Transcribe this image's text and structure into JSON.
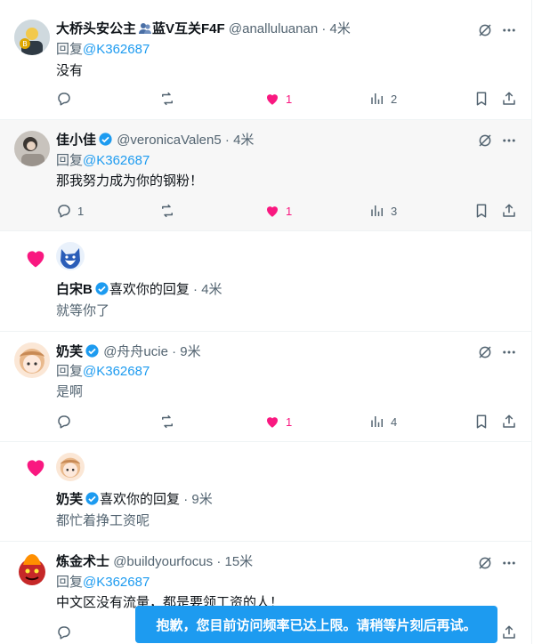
{
  "replies": [
    {
      "name": "大桥头安公主",
      "badge_text": "蓝V互关F4F",
      "handle": "@analluluanan",
      "time": "4米",
      "reply_prefix": "回复",
      "reply_to": "@K362687",
      "text": "没有",
      "counts": {
        "reply": "",
        "retweet": "",
        "like": "1",
        "views": "2"
      }
    },
    {
      "name": "佳小佳",
      "handle": "@veronicaValen5",
      "time": "4米",
      "reply_prefix": "回复",
      "reply_to": "@K362687",
      "text": "那我努力成为你的钢粉！",
      "counts": {
        "reply": "1",
        "retweet": "",
        "like": "1",
        "views": "3"
      }
    },
    {
      "name": "奶芙",
      "handle": "@舟舟ucie",
      "time": "9米",
      "reply_prefix": "回复",
      "reply_to": "@K362687",
      "text": "是啊",
      "counts": {
        "reply": "",
        "retweet": "",
        "like": "1",
        "views": "4"
      }
    },
    {
      "name": "炼金术士",
      "handle": "@buildyourfocus",
      "time": "15米",
      "reply_prefix": "回复",
      "reply_to": "@K362687",
      "text": "中文区没有流量，都是要领工资的人！",
      "counts": {
        "reply": "",
        "retweet": "",
        "like": "",
        "views": ""
      }
    }
  ],
  "likes": [
    {
      "name": "白宋B",
      "action": "喜欢你的回复",
      "time": "4米",
      "text": "就等你了"
    },
    {
      "name": "奶芙",
      "action": "喜欢你的回复",
      "time": "9米",
      "text": "都忙着挣工资呢"
    }
  ],
  "separator": "·",
  "toast": "抱歉，您目前访问频率已达上限。请稍等片刻后再试。",
  "colors": {
    "accent": "#1d9bf0",
    "like": "#f91880",
    "text": "#0f1419",
    "muted": "#536471"
  }
}
